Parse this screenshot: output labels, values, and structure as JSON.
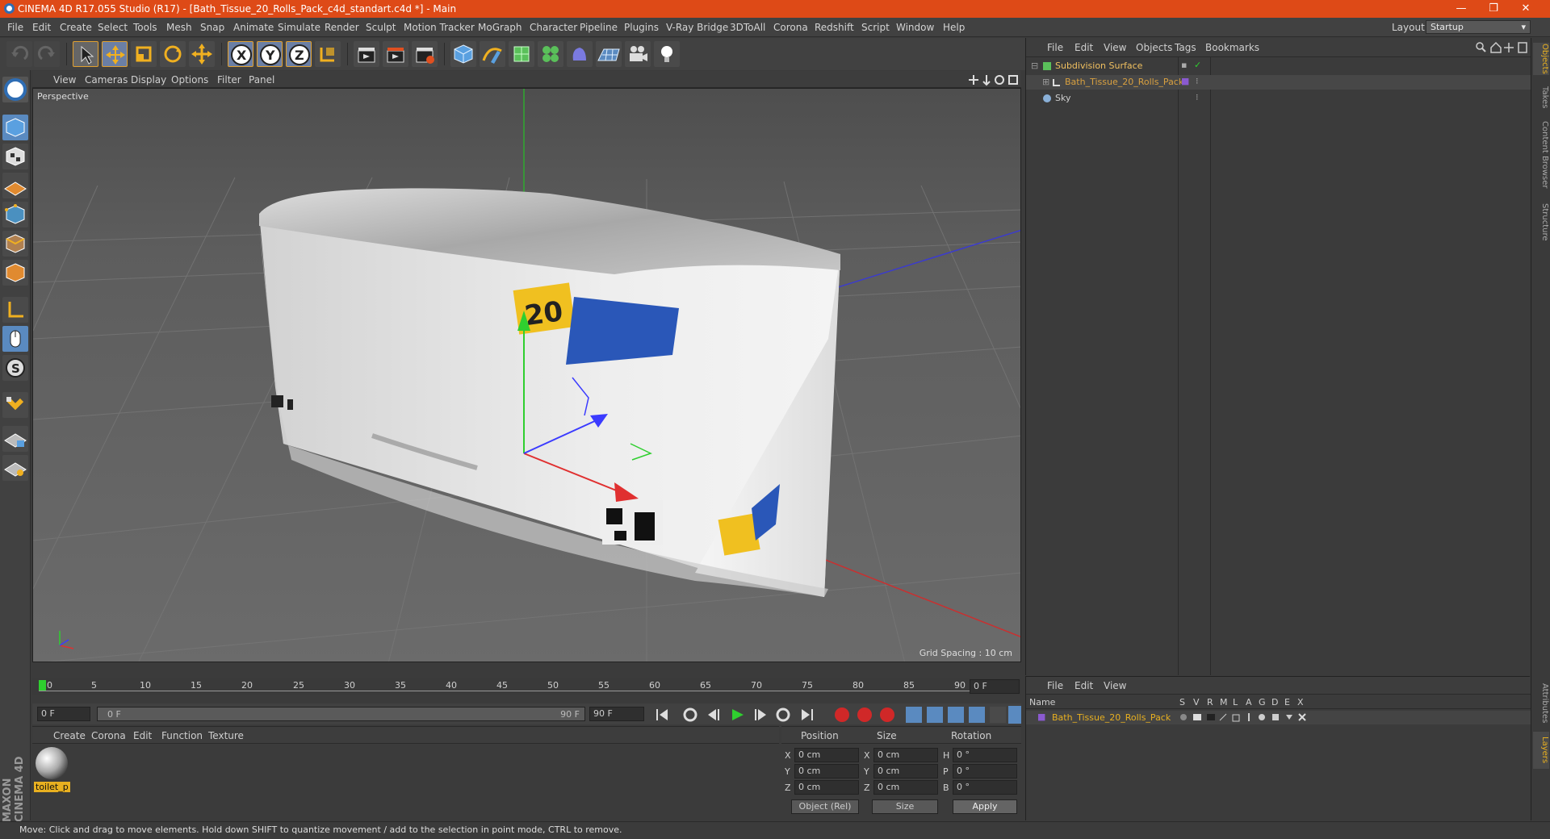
{
  "window": {
    "title": "CINEMA 4D R17.055 Studio (R17) - [Bath_Tissue_20_Rolls_Pack_c4d_standart.c4d *] - Main",
    "minimize": "—",
    "maximize": "❐",
    "close": "✕"
  },
  "menu": [
    "File",
    "Edit",
    "Create",
    "Select",
    "Tools",
    "Mesh",
    "Snap",
    "Animate",
    "Simulate",
    "Render",
    "Sculpt",
    "Motion Tracker",
    "MoGraph",
    "Character",
    "Pipeline",
    "Plugins",
    "V-Ray Bridge",
    "3DToAll",
    "Corona",
    "Redshift",
    "Script",
    "Window",
    "Help"
  ],
  "layout": {
    "label": "Layout:",
    "value": "Startup"
  },
  "viewport": {
    "menu": [
      "View",
      "Cameras",
      "Display",
      "Options",
      "Filter",
      "Panel"
    ],
    "camera_label": "Perspective",
    "grid_spacing": "Grid Spacing : 10 cm"
  },
  "timeline": {
    "ticks": [
      "0",
      "5",
      "10",
      "15",
      "20",
      "25",
      "30",
      "35",
      "40",
      "45",
      "50",
      "55",
      "60",
      "65",
      "70",
      "75",
      "80",
      "85",
      "90"
    ],
    "current_frame": "0 F",
    "start_field": "0 F",
    "range_start": "0 F",
    "range_end": "90 F",
    "end_field": "90 F"
  },
  "material_manager": {
    "menu": [
      "Create",
      "Corona",
      "Edit",
      "Function",
      "Texture"
    ],
    "materials": [
      {
        "name": "toilet_p"
      }
    ]
  },
  "coordinates": {
    "headers": [
      "Position",
      "Size",
      "Rotation"
    ],
    "rows": [
      {
        "axis": "X",
        "pos": "0 cm",
        "size_axis": "X",
        "size": "0 cm",
        "rot_axis": "H",
        "rot": "0 °"
      },
      {
        "axis": "Y",
        "pos": "0 cm",
        "size_axis": "Y",
        "size": "0 cm",
        "rot_axis": "P",
        "rot": "0 °"
      },
      {
        "axis": "Z",
        "pos": "0 cm",
        "size_axis": "Z",
        "size": "0 cm",
        "rot_axis": "B",
        "rot": "0 °"
      }
    ],
    "mode": "Object (Rel)",
    "size_mode": "Size",
    "apply": "Apply"
  },
  "object_manager": {
    "menu": [
      "File",
      "Edit",
      "View",
      "Objects",
      "Tags",
      "Bookmarks"
    ],
    "objects": [
      {
        "name": "Subdivision Surface",
        "color": "#f0c060"
      },
      {
        "name": "Bath_Tissue_20_Rolls_Pack",
        "color": "#d8a040"
      },
      {
        "name": "Sky",
        "color": "#cfcfcf"
      }
    ]
  },
  "layer_manager": {
    "menu": [
      "File",
      "Edit",
      "View"
    ],
    "name_header": "Name",
    "columns": [
      "S",
      "V",
      "R",
      "M",
      "L",
      "A",
      "G",
      "D",
      "E",
      "X"
    ],
    "layers": [
      {
        "name": "Bath_Tissue_20_Rolls_Pack"
      }
    ]
  },
  "right_tabs": [
    "Objects",
    "Takes",
    "Content Browser",
    "Structure"
  ],
  "right_tabs_bottom": [
    "Attributes",
    "Layers"
  ],
  "brand": "MAXON CINEMA 4D",
  "status": "Move: Click and drag to move elements. Hold down SHIFT to quantize movement / add to the selection in point mode, CTRL to remove."
}
